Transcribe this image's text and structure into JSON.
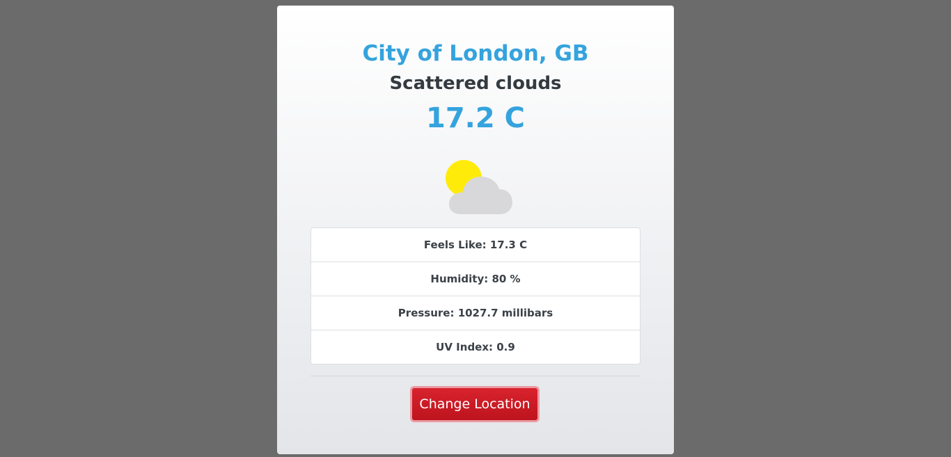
{
  "location": "City of London, GB",
  "condition": "Scattered clouds",
  "temperature": "17.2 C",
  "weather_icon": "sun-behind-cloud-icon",
  "details": [
    {
      "label": "Feels Like: 17.3 C"
    },
    {
      "label": "Humidity: 80 %"
    },
    {
      "label": "Pressure: 1027.7 millibars"
    },
    {
      "label": "UV Index: 0.9"
    }
  ],
  "change_location_label": "Change Location",
  "colors": {
    "background": "#6b6b6b",
    "accent_blue": "#35a3dd",
    "button_red": "#c81b24",
    "sun_yellow": "#ffeb0a",
    "cloud_gray": "#d8d8da"
  }
}
